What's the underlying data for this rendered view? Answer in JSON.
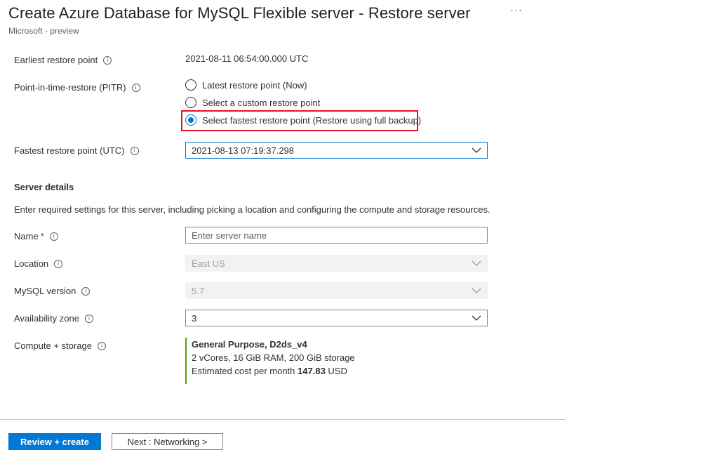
{
  "header": {
    "title": "Create Azure Database for MySQL Flexible server - Restore server",
    "more_label": "···",
    "subtitle": "Microsoft - preview"
  },
  "restore": {
    "earliest_label": "Earliest restore point",
    "earliest_value": "2021-08-11 06:54:00.000 UTC",
    "pitr_label": "Point-in-time-restore (PITR)",
    "options": [
      {
        "label": "Latest restore point (Now)",
        "selected": false
      },
      {
        "label": "Select a custom restore point",
        "selected": false
      },
      {
        "label": "Select fastest restore point (Restore using full backup)",
        "selected": true
      }
    ],
    "fastest_label": "Fastest restore point (UTC)",
    "fastest_value": "2021-08-13 07:19:37.298"
  },
  "server_details": {
    "heading": "Server details",
    "description": "Enter required settings for this server, including picking a location and configuring the compute and storage resources.",
    "name_label": "Name",
    "name_required": "*",
    "name_placeholder": "Enter server name",
    "location_label": "Location",
    "location_value": "East US",
    "version_label": "MySQL version",
    "version_value": "5.7",
    "zone_label": "Availability zone",
    "zone_value": "3",
    "compute_label": "Compute + storage",
    "compute_tier": "General Purpose, D2ds_v4",
    "compute_specs": "2 vCores, 16 GiB RAM, 200 GiB storage",
    "cost_prefix": "Estimated cost per month",
    "cost_value": "147.83",
    "cost_currency": "USD"
  },
  "footer": {
    "review_label": "Review + create",
    "next_label": "Next : Networking >"
  },
  "colors": {
    "accent": "#0078d4",
    "highlight": "#e81123",
    "compute_bar": "#57a300"
  }
}
